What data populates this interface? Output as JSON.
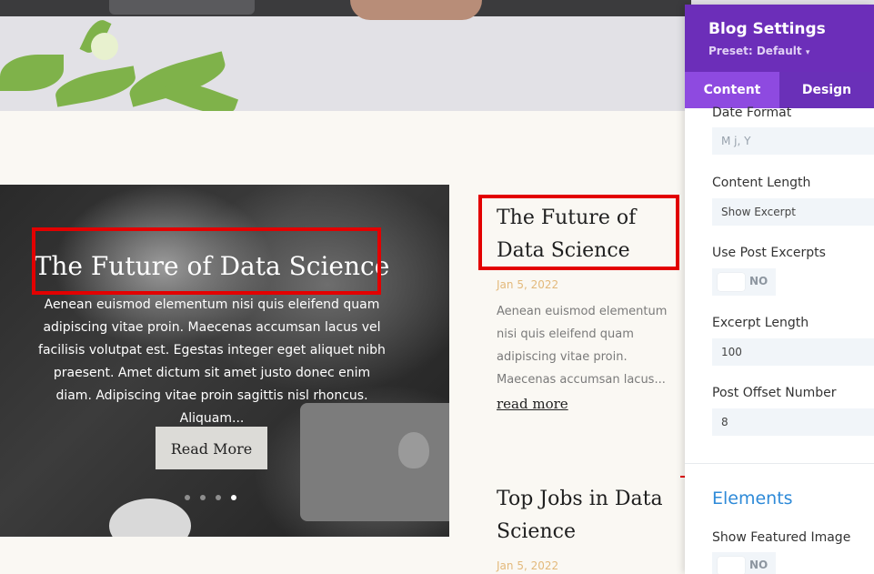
{
  "featured": {
    "title": "The Future of Data Science",
    "excerpt": "Aenean euismod elementum nisi quis eleifend quam adipiscing vitae proin. Maecenas accumsan lacus vel facilisis volutpat est. Egestas integer eget aliquet nibh praesent. Amet dictum sit amet justo donec enim diam. Adipiscing vitae proin sagittis nisl rhoncus. Aliquam...",
    "button": "Read More",
    "slide_count": 4,
    "active_slide": 4
  },
  "posts": [
    {
      "title": "The Future of Data Science",
      "date": "Jan 5, 2022",
      "excerpt": "Aenean euismod elementum nisi quis eleifend quam adipiscing vitae proin. Maecenas accumsan lacus...",
      "more": "read more"
    },
    {
      "title": "Top Jobs in Data Science",
      "date": "Jan 5, 2022"
    }
  ],
  "panel": {
    "title": "Blog Settings",
    "preset": "Preset: Default",
    "tabs": [
      "Content",
      "Design"
    ],
    "fields": {
      "date_format": {
        "label": "Date Format",
        "value": "M j, Y"
      },
      "content_length": {
        "label": "Content Length",
        "value": "Show Excerpt"
      },
      "use_post_excerpts": {
        "label": "Use Post Excerpts",
        "state": "NO"
      },
      "excerpt_length": {
        "label": "Excerpt Length",
        "value": "100"
      },
      "post_offset": {
        "label": "Post Offset Number",
        "value": "8"
      }
    },
    "elements_section": "Elements",
    "show_featured_image": {
      "label": "Show Featured Image",
      "state": "NO"
    }
  },
  "colors": {
    "panel_header": "#6c2eb9",
    "tab_bar": "#7d3dd0",
    "highlight": "#e30000",
    "date": "#e3b97b",
    "section_title": "#2e8ad8"
  }
}
